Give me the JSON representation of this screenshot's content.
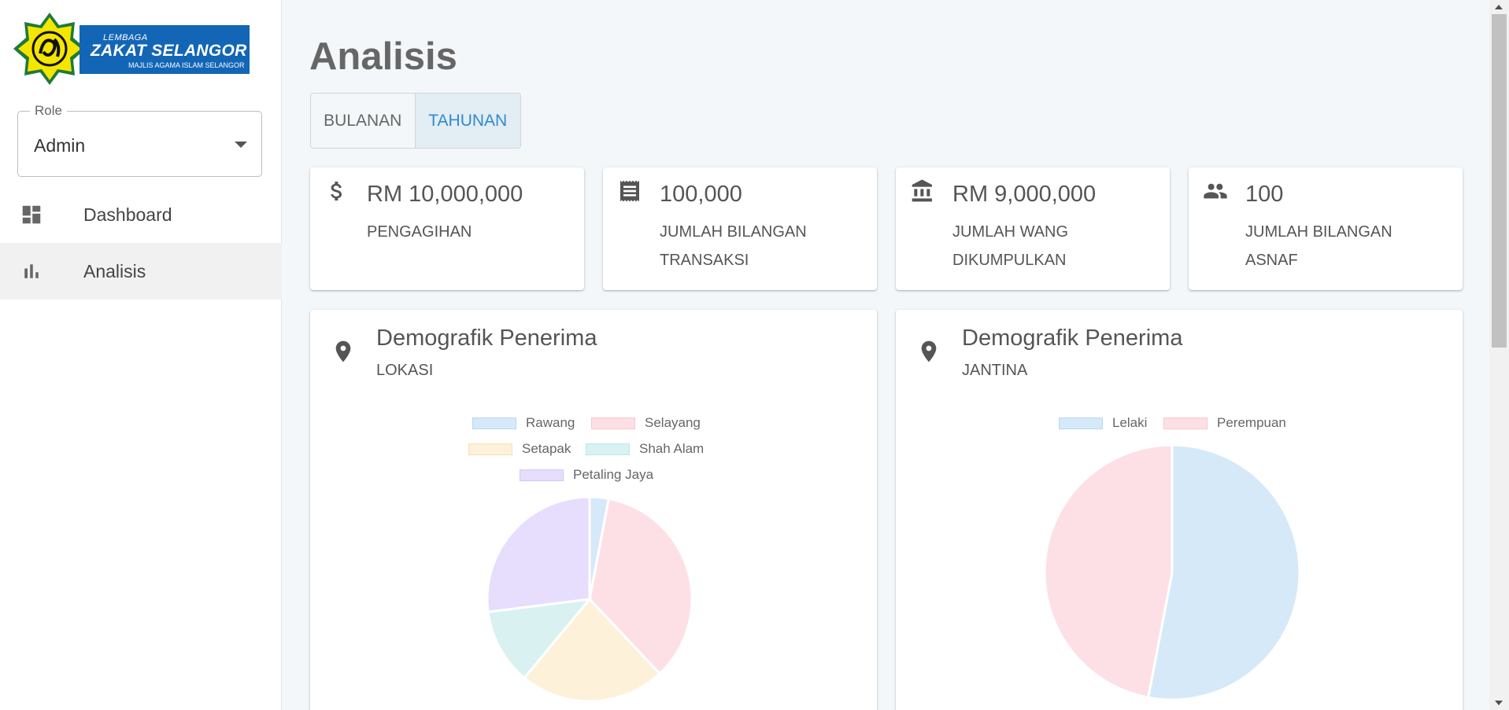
{
  "brand": {
    "line1": "LEMBAGA",
    "line2": "ZAKAT SELANGOR",
    "line3": "MAJLIS AGAMA ISLAM SELANGOR",
    "banner_color": "#1266b5",
    "badge_color": "#f5e600"
  },
  "role": {
    "label": "Role",
    "value": "Admin"
  },
  "nav": [
    {
      "label": "Dashboard",
      "icon": "dashboard-icon"
    },
    {
      "label": "Analisis",
      "icon": "bar-chart-icon",
      "active": true
    }
  ],
  "page": {
    "title": "Analisis"
  },
  "period_toggle": {
    "options": [
      "BULANAN",
      "TAHUNAN"
    ],
    "selected": "TAHUNAN"
  },
  "stats": [
    {
      "icon": "dollar-icon",
      "value": "RM 10,000,000",
      "label": "PENGAGIHAN"
    },
    {
      "icon": "receipt-icon",
      "value": "100,000",
      "label": "JUMLAH BILANGAN TRANSAKSI"
    },
    {
      "icon": "bank-icon",
      "value": "RM 9,000,000",
      "label": "JUMLAH WANG DIKUMPULKAN"
    },
    {
      "icon": "people-icon",
      "value": "100",
      "label": "JUMLAH BILANGAN ASNAF"
    }
  ],
  "charts": [
    {
      "icon": "location-pin-icon",
      "title": "Demografik Penerima",
      "subtitle": "LOKASI"
    },
    {
      "icon": "location-pin-icon",
      "title": "Demografik Penerima",
      "subtitle": "JANTINA"
    }
  ],
  "chart_data": [
    {
      "type": "pie",
      "categories": [
        "Rawang",
        "Selayang",
        "Setapak",
        "Shah Alam",
        "Petaling Jaya"
      ],
      "values": [
        3,
        35,
        23,
        12,
        27
      ],
      "colors": [
        "#d6e9f8",
        "#fde0e6",
        "#fdf1d9",
        "#daf1f1",
        "#e6defc"
      ],
      "border_colors": [
        "#b7d8f2",
        "#f9c6d1",
        "#f8e1b3",
        "#bfe6e6",
        "#d2c6fa"
      ],
      "legend": "top"
    },
    {
      "type": "pie",
      "categories": [
        "Lelaki",
        "Perempuan"
      ],
      "values": [
        53,
        47
      ],
      "colors": [
        "#d6e9f8",
        "#fde0e6"
      ],
      "border_colors": [
        "#b7d8f2",
        "#f9c6d1"
      ],
      "legend": "top"
    }
  ]
}
